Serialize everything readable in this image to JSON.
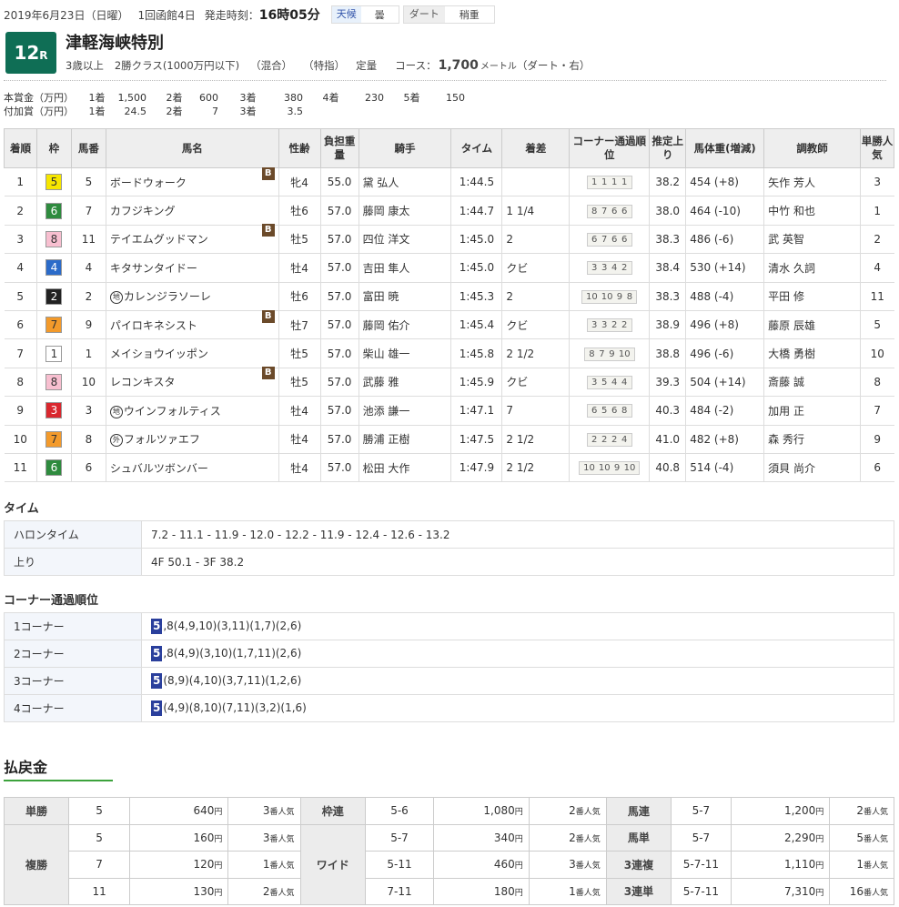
{
  "header": {
    "date": "2019年6月23日（日曜）",
    "meeting": "1回函館4日",
    "start_label": "発走時刻：",
    "start_time": "16時05分",
    "weather_tag": "天候",
    "weather_val": "曇",
    "surface_tag": "ダート",
    "surface_val": "稍重"
  },
  "race": {
    "number": "12",
    "r": "R",
    "name": "津軽海峡特別",
    "cond_age": "3歳以上",
    "cond_class": "2勝クラス(1000万円以下)",
    "cond_mix": "（混合）",
    "cond_designated": "（特指）",
    "cond_weight": "定量",
    "course_label": "コース：",
    "distance": "1,700",
    "distance_unit": "メートル",
    "course_detail": "（ダート・右）"
  },
  "prize": {
    "main": [
      "本賞金（万円）",
      "1着",
      "1,500",
      "2着",
      "600",
      "3着",
      "380",
      "4着",
      "230",
      "5着",
      "150"
    ],
    "added": [
      "付加賞（万円）",
      "1着",
      "24.5",
      "2着",
      "7",
      "3着",
      "3.5"
    ]
  },
  "table_headers": [
    "着順",
    "枠",
    "馬番",
    "馬名",
    "性齢",
    "負担重量",
    "騎手",
    "タイム",
    "着差",
    "コーナー通過順位",
    "推定上り",
    "馬体重(増減)",
    "調教師",
    "単勝人気"
  ],
  "rows": [
    {
      "pos": "1",
      "waku": "5",
      "waku_bg": "#f6e600",
      "waku_fg": "#333",
      "num": "5",
      "mark": "",
      "name": "ボードウォーク",
      "blinker": true,
      "sa": "牝4",
      "wt": "55.0",
      "jockey": "黛 弘人",
      "time": "1:44.5",
      "margin": "",
      "corners": [
        "1",
        "1",
        "1",
        "1"
      ],
      "agari": "38.2",
      "bw": "454 (+8)",
      "trainer": "矢作 芳人",
      "pop": "3"
    },
    {
      "pos": "2",
      "waku": "6",
      "waku_bg": "#2e8b3e",
      "waku_fg": "#fff",
      "num": "7",
      "mark": "",
      "name": "カフジキング",
      "blinker": false,
      "sa": "牡6",
      "wt": "57.0",
      "jockey": "藤岡 康太",
      "time": "1:44.7",
      "margin": "1 1/4",
      "corners": [
        "8",
        "7",
        "6",
        "6"
      ],
      "agari": "38.0",
      "bw": "464 (-10)",
      "trainer": "中竹 和也",
      "pop": "1"
    },
    {
      "pos": "3",
      "waku": "8",
      "waku_bg": "#f8bfd0",
      "waku_fg": "#333",
      "num": "11",
      "mark": "",
      "name": "テイエムグッドマン",
      "blinker": true,
      "sa": "牡5",
      "wt": "57.0",
      "jockey": "四位 洋文",
      "time": "1:45.0",
      "margin": "2",
      "corners": [
        "6",
        "7",
        "6",
        "6"
      ],
      "agari": "38.3",
      "bw": "486 (-6)",
      "trainer": "武 英智",
      "pop": "2"
    },
    {
      "pos": "4",
      "waku": "4",
      "waku_bg": "#2b6bc9",
      "waku_fg": "#fff",
      "num": "4",
      "mark": "",
      "name": "キタサンタイドー",
      "blinker": false,
      "sa": "牡4",
      "wt": "57.0",
      "jockey": "吉田 隼人",
      "time": "1:45.0",
      "margin": "クビ",
      "corners": [
        "3",
        "3",
        "4",
        "2"
      ],
      "agari": "38.4",
      "bw": "530 (+14)",
      "trainer": "清水 久詞",
      "pop": "4"
    },
    {
      "pos": "5",
      "waku": "2",
      "waku_bg": "#222",
      "waku_fg": "#fff",
      "num": "2",
      "mark": "地",
      "name": "カレンジラソーレ",
      "blinker": false,
      "sa": "牡6",
      "wt": "57.0",
      "jockey": "富田 暁",
      "time": "1:45.3",
      "margin": "2",
      "corners": [
        "10",
        "10",
        "9",
        "8"
      ],
      "agari": "38.3",
      "bw": "488 (-4)",
      "trainer": "平田 修",
      "pop": "11"
    },
    {
      "pos": "6",
      "waku": "7",
      "waku_bg": "#f39a2b",
      "waku_fg": "#333",
      "num": "9",
      "mark": "",
      "name": "パイロキネシスト",
      "blinker": true,
      "sa": "牡7",
      "wt": "57.0",
      "jockey": "藤岡 佑介",
      "time": "1:45.4",
      "margin": "クビ",
      "corners": [
        "3",
        "3",
        "2",
        "2"
      ],
      "agari": "38.9",
      "bw": "496 (+8)",
      "trainer": "藤原 辰雄",
      "pop": "5"
    },
    {
      "pos": "7",
      "waku": "1",
      "waku_bg": "#ffffff",
      "waku_fg": "#333",
      "num": "1",
      "mark": "",
      "name": "メイショウイッポン",
      "blinker": false,
      "sa": "牡5",
      "wt": "57.0",
      "jockey": "柴山 雄一",
      "time": "1:45.8",
      "margin": "2 1/2",
      "corners": [
        "8",
        "7",
        "9",
        "10"
      ],
      "agari": "38.8",
      "bw": "496 (-6)",
      "trainer": "大橋 勇樹",
      "pop": "10"
    },
    {
      "pos": "8",
      "waku": "8",
      "waku_bg": "#f8bfd0",
      "waku_fg": "#333",
      "num": "10",
      "mark": "",
      "name": "レコンキスタ",
      "blinker": true,
      "sa": "牡5",
      "wt": "57.0",
      "jockey": "武藤 雅",
      "time": "1:45.9",
      "margin": "クビ",
      "corners": [
        "3",
        "5",
        "4",
        "4"
      ],
      "agari": "39.3",
      "bw": "504 (+14)",
      "trainer": "斎藤 誠",
      "pop": "8"
    },
    {
      "pos": "9",
      "waku": "3",
      "waku_bg": "#d9272e",
      "waku_fg": "#fff",
      "num": "3",
      "mark": "地",
      "name": "ウインフォルティス",
      "blinker": false,
      "sa": "牡4",
      "wt": "57.0",
      "jockey": "池添 謙一",
      "time": "1:47.1",
      "margin": "7",
      "corners": [
        "6",
        "5",
        "6",
        "8"
      ],
      "agari": "40.3",
      "bw": "484 (-2)",
      "trainer": "加用 正",
      "pop": "7"
    },
    {
      "pos": "10",
      "waku": "7",
      "waku_bg": "#f39a2b",
      "waku_fg": "#333",
      "num": "8",
      "mark": "外",
      "name": "フォルツァエフ",
      "blinker": false,
      "sa": "牡4",
      "wt": "57.0",
      "jockey": "勝浦 正樹",
      "time": "1:47.5",
      "margin": "2 1/2",
      "corners": [
        "2",
        "2",
        "2",
        "4"
      ],
      "agari": "41.0",
      "bw": "482 (+8)",
      "trainer": "森 秀行",
      "pop": "9"
    },
    {
      "pos": "11",
      "waku": "6",
      "waku_bg": "#2e8b3e",
      "waku_fg": "#fff",
      "num": "6",
      "mark": "",
      "name": "シュバルツボンバー",
      "blinker": false,
      "sa": "牡4",
      "wt": "57.0",
      "jockey": "松田 大作",
      "time": "1:47.9",
      "margin": "2 1/2",
      "corners": [
        "10",
        "10",
        "9",
        "10"
      ],
      "agari": "40.8",
      "bw": "514 (-4)",
      "trainer": "須貝 尚介",
      "pop": "6"
    }
  ],
  "blinker_label": "B",
  "time_section": {
    "title": "タイム",
    "furlong_label": "ハロンタイム",
    "furlong_value": "7.2 - 11.1 - 11.9 - 12.0 - 12.2 - 11.9 - 12.4 - 12.6 - 13.2",
    "agari_label": "上り",
    "agari_value": "4F 50.1 - 3F 38.2"
  },
  "corner_section": {
    "title": "コーナー通過順位",
    "rows": [
      {
        "label": "1コーナー",
        "lead": "5",
        "rest": ",8(4,9,10)(3,11)(1,7)(2,6)"
      },
      {
        "label": "2コーナー",
        "lead": "5",
        "rest": ",8(4,9)(3,10)(1,7,11)(2,6)"
      },
      {
        "label": "3コーナー",
        "lead": "5",
        "rest": "(8,9)(4,10)(3,7,11)(1,2,6)"
      },
      {
        "label": "4コーナー",
        "lead": "5",
        "rest": "(4,9)(8,10)(7,11)(3,2)(1,6)"
      }
    ]
  },
  "payout": {
    "title": "払戻金",
    "yen": "円",
    "tan": {
      "label": "単勝",
      "num": "5",
      "amt": "640",
      "pop": "3",
      "poplabel": "番人気"
    },
    "fuku": {
      "label": "複勝",
      "items": [
        {
          "num": "5",
          "amt": "160",
          "pop": "3"
        },
        {
          "num": "7",
          "amt": "120",
          "pop": "1"
        },
        {
          "num": "11",
          "amt": "130",
          "pop": "2"
        }
      ]
    },
    "wakuren": {
      "label": "枠連",
      "num": "5-6",
      "amt": "1,080",
      "pop": "2"
    },
    "wide": {
      "label": "ワイド",
      "items": [
        {
          "num": "5-7",
          "amt": "340",
          "pop": "2"
        },
        {
          "num": "5-11",
          "amt": "460",
          "pop": "3"
        },
        {
          "num": "7-11",
          "amt": "180",
          "pop": "1"
        }
      ]
    },
    "umaren": {
      "label": "馬連",
      "num": "5-7",
      "amt": "1,200",
      "pop": "2"
    },
    "umatan": {
      "label": "馬単",
      "num": "5-7",
      "amt": "2,290",
      "pop": "5"
    },
    "sanrenpuku": {
      "label": "3連複",
      "num": "5-7-11",
      "amt": "1,110",
      "pop": "1"
    },
    "sanrentan": {
      "label": "3連単",
      "num": "5-7-11",
      "amt": "7,310",
      "pop": "16"
    }
  }
}
